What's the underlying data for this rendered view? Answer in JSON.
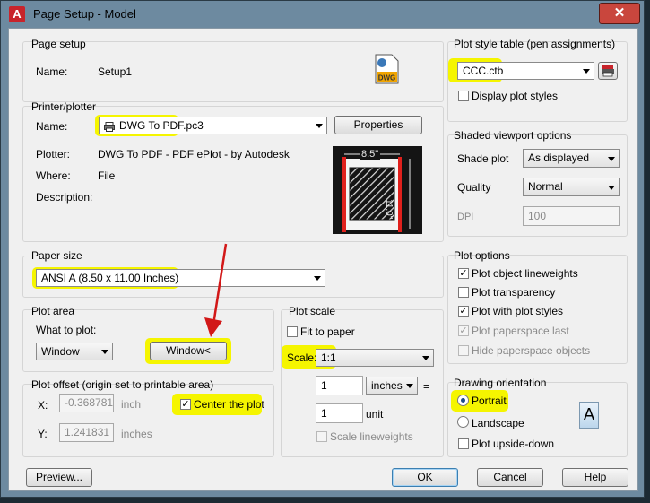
{
  "window": {
    "title": "Page Setup - Model",
    "close_glyph": "✕",
    "app_glyph": "A"
  },
  "page_setup": {
    "group": "Page setup",
    "name_label": "Name:",
    "name_value": "Setup1"
  },
  "printer": {
    "group": "Printer/plotter",
    "name_label": "Name:",
    "name_value": "DWG To PDF.pc3",
    "properties_button": "Properties",
    "plotter_label": "Plotter:",
    "plotter_value": "DWG To PDF - PDF ePlot - by Autodesk",
    "where_label": "Where:",
    "where_value": "File",
    "description_label": "Description:",
    "preview_width": "8.5\"",
    "preview_height": "11.0\""
  },
  "paper_size": {
    "group": "Paper size",
    "value": "ANSI A (8.50 x 11.00 Inches)"
  },
  "plot_area": {
    "group": "Plot area",
    "what_label": "What to plot:",
    "what_value": "Window",
    "window_button": "Window<"
  },
  "plot_offset": {
    "group": "Plot offset (origin set to printable area)",
    "x_label": "X:",
    "x_value": "-0.368781",
    "x_unit": "inch",
    "y_label": "Y:",
    "y_value": "1.241831",
    "y_unit": "inches",
    "center_label": "Center the plot"
  },
  "plot_scale": {
    "group": "Plot scale",
    "fit_label": "Fit to paper",
    "scale_label": "Scale:",
    "scale_value": "1:1",
    "value1": "1",
    "unit1": "inches",
    "equals": "=",
    "value2": "1",
    "unit2": "unit",
    "lineweights_label": "Scale lineweights"
  },
  "plot_style": {
    "group": "Plot style table (pen assignments)",
    "value": "CCC.ctb",
    "display_label": "Display plot styles"
  },
  "shaded": {
    "group": "Shaded viewport options",
    "shade_label": "Shade plot",
    "shade_value": "As displayed",
    "quality_label": "Quality",
    "quality_value": "Normal",
    "dpi_label": "DPI",
    "dpi_value": "100"
  },
  "plot_options": {
    "group": "Plot options",
    "items": [
      "Plot object lineweights",
      "Plot transparency",
      "Plot with plot styles",
      "Plot paperspace last",
      "Hide paperspace objects"
    ]
  },
  "orientation": {
    "group": "Drawing orientation",
    "portrait": "Portrait",
    "landscape": "Landscape",
    "upside": "Plot upside-down",
    "icon_letter": "A"
  },
  "buttons": {
    "preview": "Preview...",
    "ok": "OK",
    "cancel": "Cancel",
    "help": "Help"
  },
  "highlight_color": "#f5f500",
  "annotation_arrow_color": "#d21818"
}
